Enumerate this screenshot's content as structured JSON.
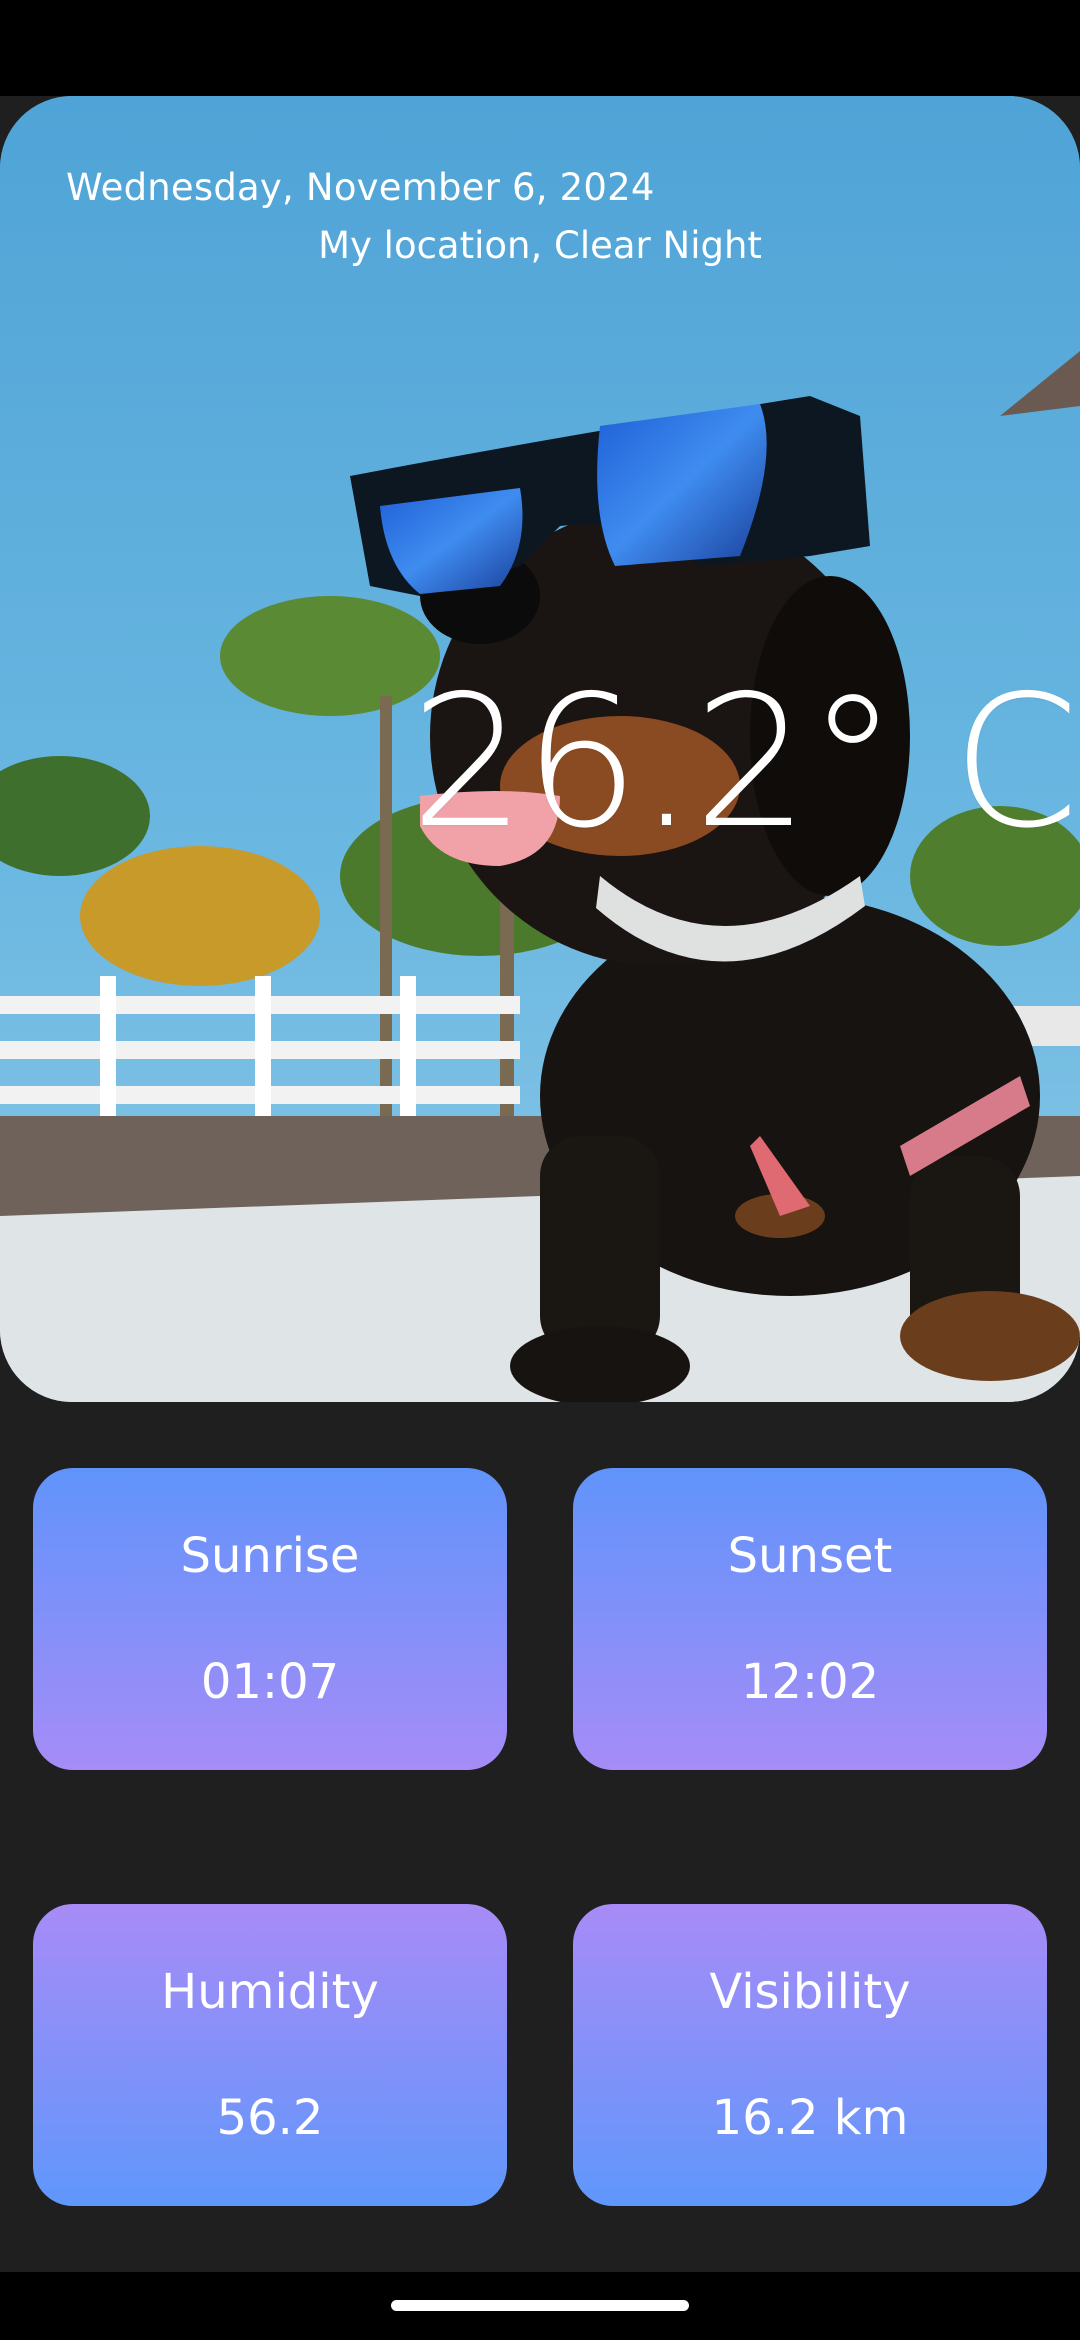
{
  "hero": {
    "date": "Wednesday, November 6, 2024",
    "location": "My location, Clear Night",
    "temperature": "26.2° C",
    "background_image": "photo of a dachshund wearing blue mirrored sunglasses on a beach"
  },
  "cards": [
    {
      "label": "Sunrise",
      "value": "01:07"
    },
    {
      "label": "Sunset",
      "value": "12:02"
    },
    {
      "label": "Humidity",
      "value": "56.2"
    },
    {
      "label": "Visibility",
      "value": "16.2 km"
    }
  ],
  "colors": {
    "background": "#1f1f1f",
    "card_blue": "#6094fb",
    "card_purple": "#a68cf7",
    "text": "#ffffff"
  }
}
